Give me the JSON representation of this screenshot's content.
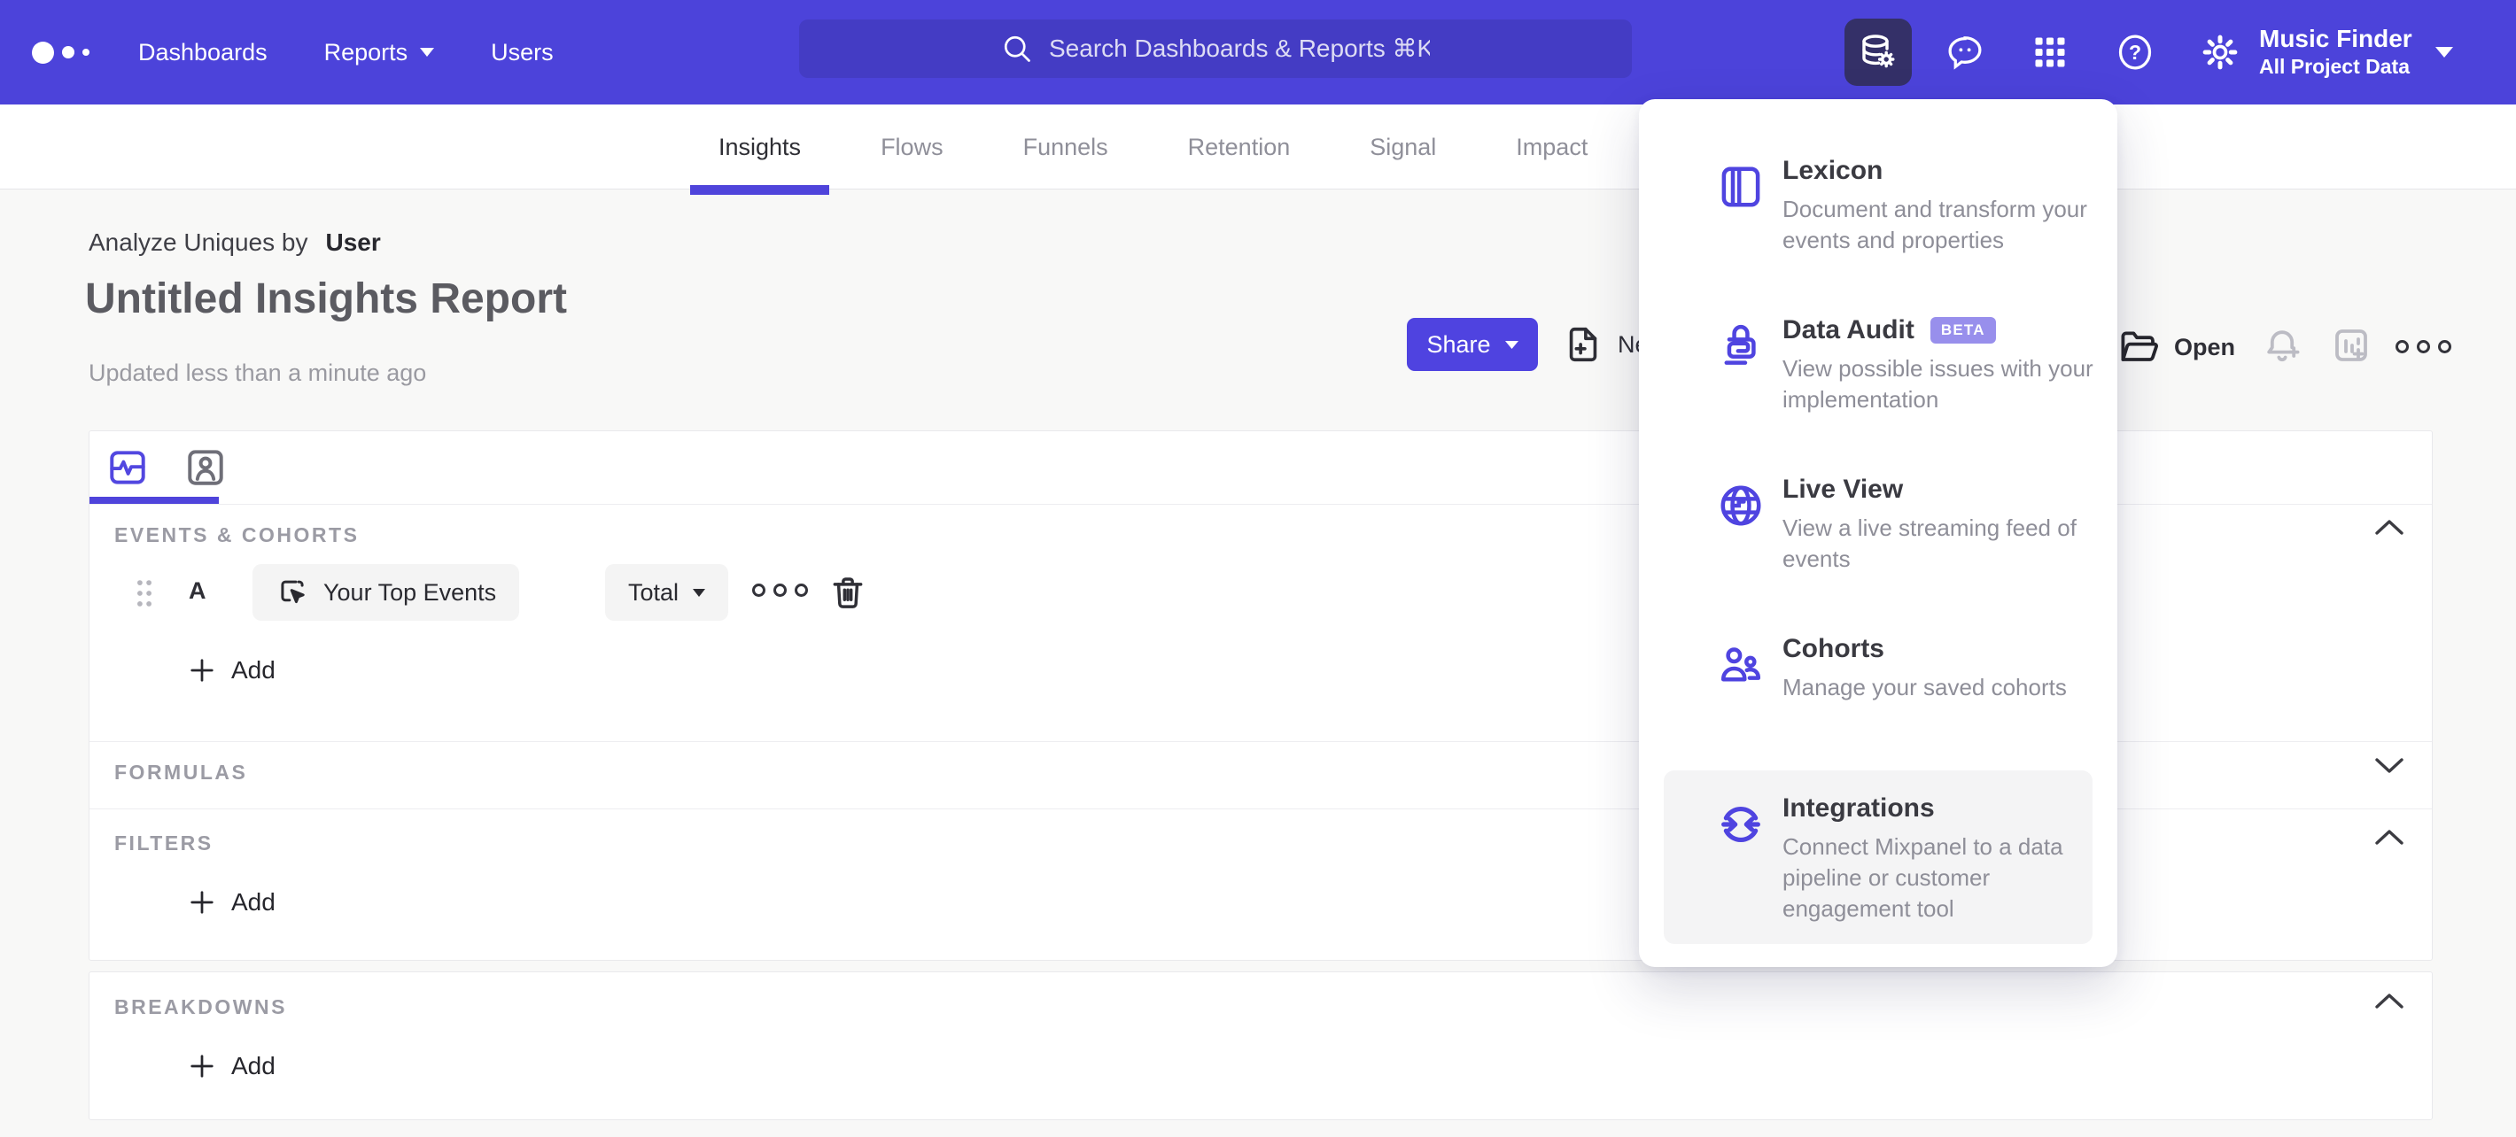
{
  "nav": {
    "links": [
      {
        "label": "Dashboards"
      },
      {
        "label": "Reports"
      },
      {
        "label": "Users"
      }
    ],
    "search_placeholder": "Search Dashboards & Reports ⌘K",
    "project": {
      "name": "Music Finder",
      "scope": "All Project Data"
    }
  },
  "report_tabs": {
    "items": [
      {
        "label": "Insights"
      },
      {
        "label": "Flows"
      },
      {
        "label": "Funnels"
      },
      {
        "label": "Retention"
      },
      {
        "label": "Signal"
      },
      {
        "label": "Impact"
      }
    ],
    "active": "Insights"
  },
  "header": {
    "analyze_prefix": "Analyze Uniques by",
    "analyze_value": "User",
    "title": "Untitled Insights Report",
    "updated": "Updated less than a minute ago",
    "share_label": "Share",
    "new_label": "New",
    "open_label": "Open"
  },
  "builder": {
    "events_label": "EVENTS & COHORTS",
    "formulas_label": "FORMULAS",
    "filters_label": "FILTERS",
    "breakdowns_label": "BREAKDOWNS",
    "add_label": "Add",
    "row": {
      "letter": "A",
      "event": "Your Top Events",
      "aggregation": "Total"
    }
  },
  "menu": {
    "items": [
      {
        "title": "Lexicon",
        "description": "Document and transform your events and properties"
      },
      {
        "title": "Data Audit",
        "badge": "BETA",
        "description": "View possible issues with your implementation"
      },
      {
        "title": "Live View",
        "description": "View a live streaming feed of events"
      },
      {
        "title": "Cohorts",
        "description": "Manage your saved cohorts"
      },
      {
        "title": "Integrations",
        "description": "Connect Mixpanel to a data pipeline or customer engagement tool"
      }
    ]
  },
  "colors": {
    "nav_bg": "#4c43da",
    "search_bg": "#443cc4",
    "active_tile_bg": "#343068",
    "accent": "#4f44db",
    "page_bg": "#f8f8f7",
    "beta_badge": "#988fec"
  }
}
